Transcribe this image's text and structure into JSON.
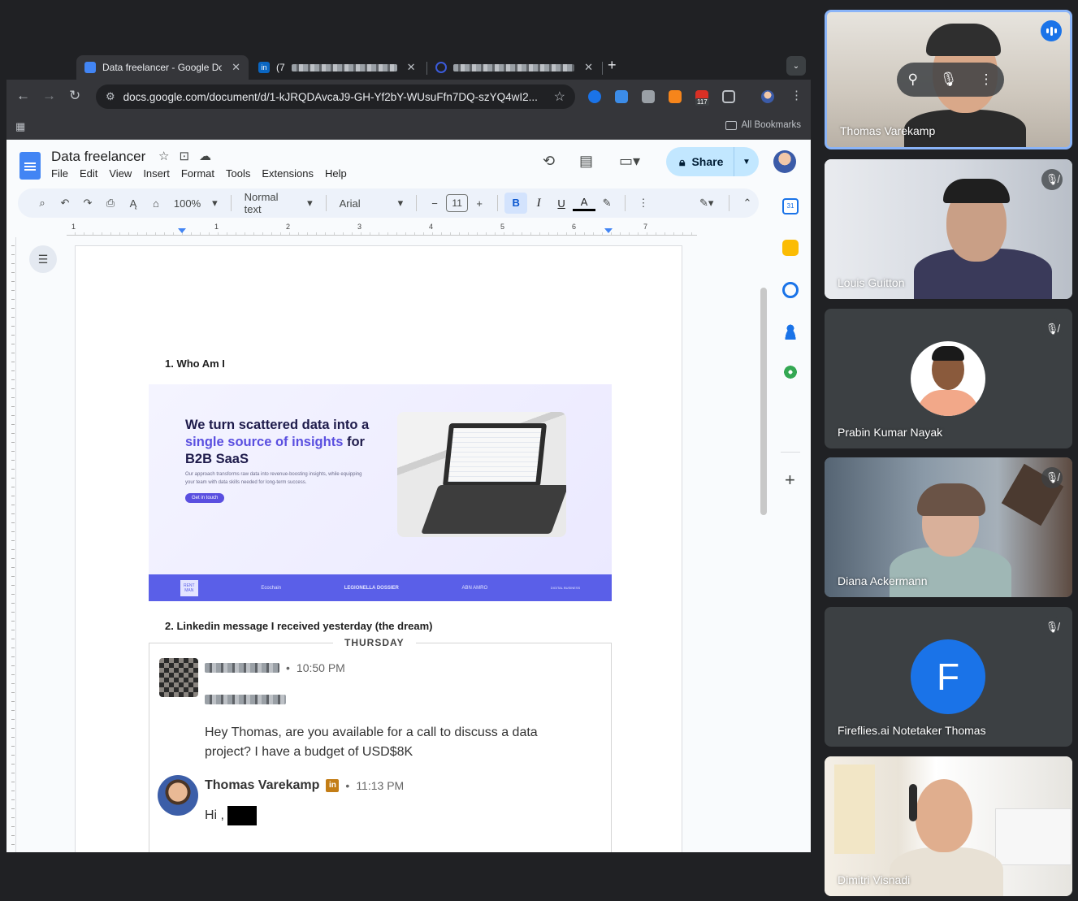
{
  "browser": {
    "tabs": [
      {
        "title": "Data freelancer - Google Doc",
        "active": true
      },
      {
        "title": "(7",
        "active": false
      },
      {
        "title": "",
        "active": false
      }
    ],
    "url": "docs.google.com/document/d/1-kJRQDAvcaJ9-GH-Yf2bY-WUsuFfn7DQ-szYQ4wI2...",
    "extension_badge": "117",
    "all_bookmarks": "All Bookmarks"
  },
  "doc": {
    "title": "Data freelancer",
    "menu": [
      "File",
      "Edit",
      "View",
      "Insert",
      "Format",
      "Tools",
      "Extensions",
      "Help"
    ],
    "share_label": "Share",
    "toolbar": {
      "zoom": "100%",
      "style": "Normal text",
      "font": "Arial",
      "font_size": "11"
    },
    "ruler_numbers": [
      "1",
      "1",
      "2",
      "3",
      "4",
      "5",
      "6",
      "7"
    ],
    "heading1": "1.  Who Am I",
    "hero": {
      "headline_a": "We turn scattered data into a ",
      "headline_highlight": "single source of insights",
      "headline_b": " for B2B SaaS",
      "paragraph": "Our approach transforms raw data into revenue-boosting insights, while equipping your team with data skills needed for long-term success.",
      "button": "Get in touch",
      "logos": [
        "RENT MAN",
        "Ecochain",
        "LEGIONELLA DOSSIER",
        "ABN AMRO",
        "DIGITAL BUSINESS"
      ]
    },
    "heading2": "2.  Linkedin message I received yesterday (the dream)",
    "message": {
      "day": "THURSDAY",
      "incoming_time": "10:50 PM",
      "incoming_text": "Hey Thomas, are you available for a call to discuss a data project? I have a budget of USD$8K",
      "reply_name": "Thomas Varekamp",
      "reply_time": "11:13 PM",
      "reply_text": "Hi ,",
      "linkedin_badge": "in"
    }
  },
  "participants": [
    {
      "name": "Thomas Varekamp",
      "speaking": true
    },
    {
      "name": "Louis Guitton",
      "muted": true
    },
    {
      "name": "Prabin Kumar Nayak",
      "muted": true
    },
    {
      "name": "Diana Ackermann",
      "muted": true
    },
    {
      "name": "Fireflies.ai Notetaker Thomas",
      "muted": true,
      "initial": "F",
      "color": "#1a73e8"
    },
    {
      "name": "Dimitri Visnadi",
      "muted": false
    }
  ]
}
